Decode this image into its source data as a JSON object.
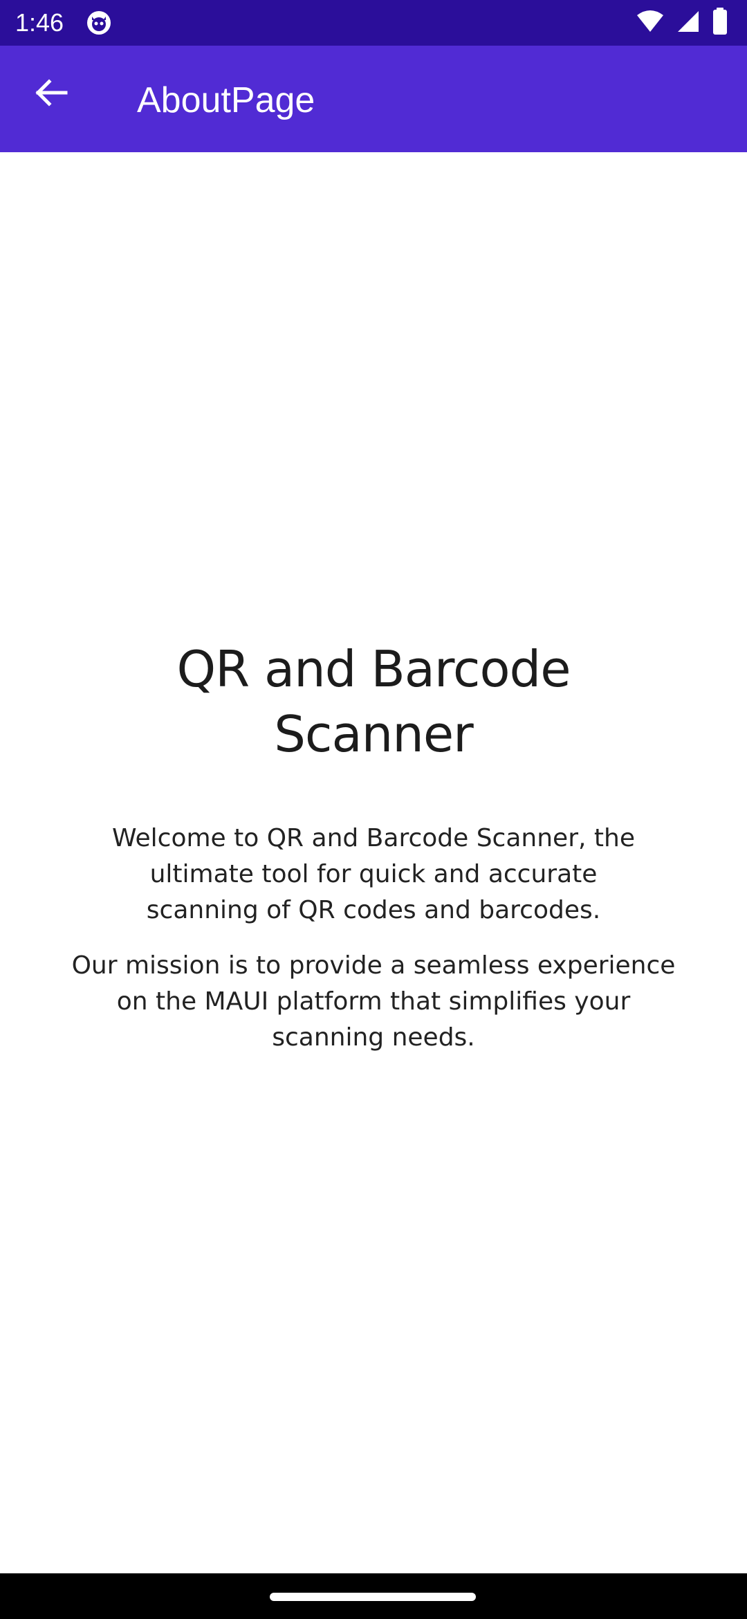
{
  "status_bar": {
    "time": "1:46",
    "icons": [
      "app-notification-icon",
      "wifi-icon",
      "signal-icon",
      "battery-icon"
    ]
  },
  "app_bar": {
    "title": "AboutPage",
    "back_icon": "arrow-back-icon",
    "background_color": "#512bd4",
    "status_bar_color": "#2b0e9a"
  },
  "content": {
    "heading": "QR and Barcode Scanner",
    "paragraph_1": "Welcome to QR and Barcode Scanner, the ultimate tool for quick and accurate scanning of QR codes and barcodes.",
    "paragraph_2": "Our mission is to provide a seamless experience on the MAUI platform that simplifies your scanning needs."
  }
}
